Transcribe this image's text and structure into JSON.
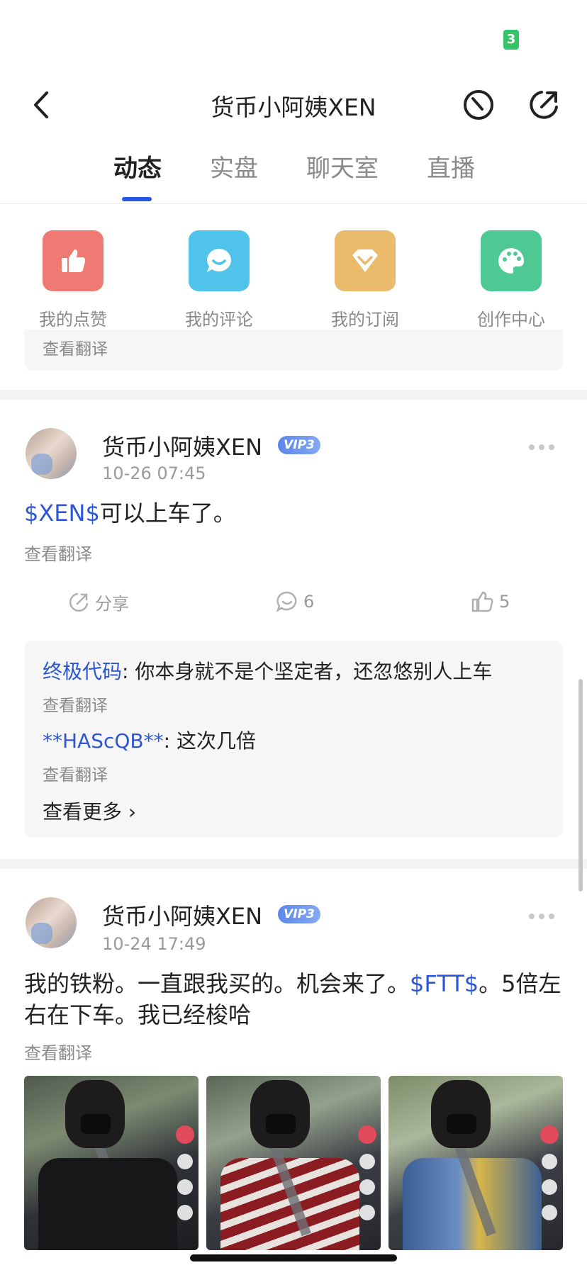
{
  "status": {
    "badge": "3"
  },
  "nav": {
    "title": "货币小阿姨XEN"
  },
  "tabs": [
    "动态",
    "实盘",
    "聊天室",
    "直播"
  ],
  "quick_actions": [
    {
      "label": "我的点赞",
      "icon": "thumbs-up-icon",
      "color": "#ef7a73"
    },
    {
      "label": "我的评论",
      "icon": "chat-bubble-icon",
      "color": "#4fc3ea"
    },
    {
      "label": "我的订阅",
      "icon": "diamond-icon",
      "color": "#e9bb6a"
    },
    {
      "label": "创作中心",
      "icon": "palette-icon",
      "color": "#4fc993"
    }
  ],
  "prev_card": {
    "translate": "查看翻译"
  },
  "posts": [
    {
      "author": "货币小阿姨XEN",
      "vip": "VIP3",
      "time": "10-26 07:45",
      "link": "$XEN$",
      "text_after": "可以上车了。",
      "translate": "查看翻译",
      "share": "分享",
      "comments_count": "6",
      "likes_count": "5",
      "comments": [
        {
          "user": "终极代码",
          "text": ": 你本身就不是个坚定者，还忽悠别人上车",
          "translate": "查看翻译"
        },
        {
          "user": "**HAScQB**",
          "text": ": 这次几倍",
          "translate": "查看翻译"
        }
      ],
      "see_more": "查看更多"
    },
    {
      "author": "货币小阿姨XEN",
      "vip": "VIP3",
      "time": "10-24 17:49",
      "text_before": "我的铁粉。一直跟我买的。机会来了。",
      "link": "$FTT$",
      "text_after": "。5倍左右在下车。我已经梭哈",
      "translate": "查看翻译"
    }
  ],
  "colors": {
    "accent": "#2457e6",
    "link": "#2d56d6"
  }
}
